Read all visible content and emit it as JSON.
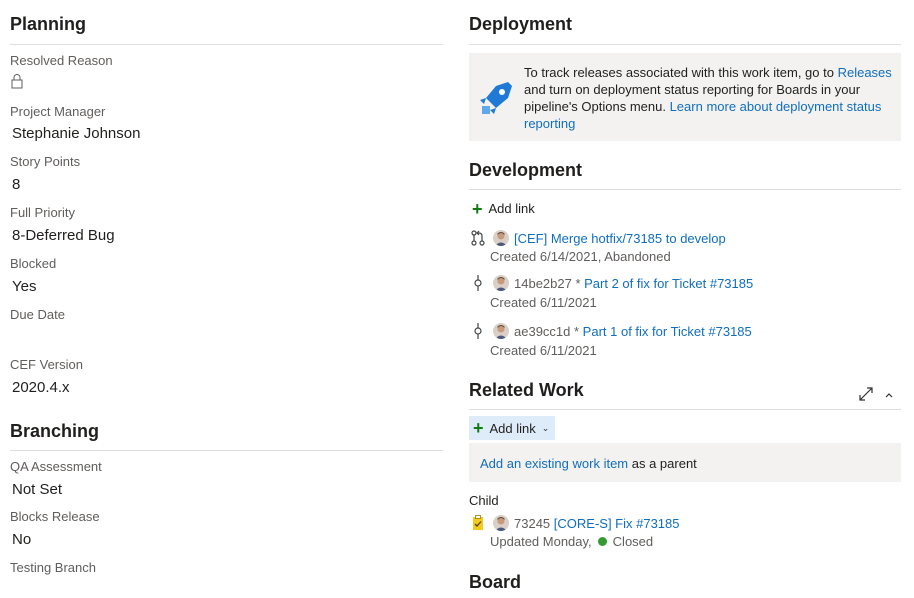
{
  "planning": {
    "title": "Planning",
    "fields": {
      "resolved_reason": {
        "label": "Resolved Reason"
      },
      "project_manager": {
        "label": "Project Manager",
        "value": "Stephanie Johnson"
      },
      "story_points": {
        "label": "Story Points",
        "value": "8"
      },
      "full_priority": {
        "label": "Full Priority",
        "value": "8-Deferred Bug"
      },
      "blocked": {
        "label": "Blocked",
        "value": "Yes"
      },
      "due_date": {
        "label": "Due Date",
        "value": ""
      },
      "cef_version": {
        "label": "CEF Version",
        "value": "2020.4.x"
      }
    }
  },
  "branching": {
    "title": "Branching",
    "fields": {
      "qa_assessment": {
        "label": "QA Assessment",
        "value": "Not Set"
      },
      "blocks_release": {
        "label": "Blocks Release",
        "value": "No"
      },
      "testing_branch": {
        "label": "Testing Branch"
      }
    }
  },
  "deployment": {
    "title": "Deployment",
    "text_1": "To track releases associated with this work item, go to ",
    "releases_link": "Releases",
    "text_2": " and turn on deployment status reporting for Boards in your pipeline's Options menu. ",
    "learn_more_link": "Learn more about deployment status reporting"
  },
  "development": {
    "title": "Development",
    "add_link": "Add link",
    "items": [
      {
        "prefix": "",
        "link": "[CEF] Merge hotfix/73185 to develop",
        "meta": "Created 6/14/2021,  Abandoned"
      },
      {
        "prefix": "14be2b27 * ",
        "link": "Part 2 of fix for Ticket #73185",
        "meta": "Created 6/11/2021"
      },
      {
        "prefix": "ae39cc1d * ",
        "link": "Part 1 of fix for Ticket #73185",
        "meta": "Created 6/11/2021"
      }
    ]
  },
  "related_work": {
    "title": "Related Work",
    "add_link": "Add link",
    "existing_link": "Add an existing work item",
    "existing_suffix": " as a parent",
    "child_label": "Child",
    "child": {
      "id": "73245",
      "link": "[CORE-S] Fix #73185",
      "meta": "Updated Monday,",
      "state": "Closed",
      "state_color": "#339933"
    }
  },
  "board": {
    "title": "Board"
  },
  "colors": {
    "link": "#106ebe",
    "accent_plus": "#107c10",
    "task_icon": "#f2cb1d"
  }
}
